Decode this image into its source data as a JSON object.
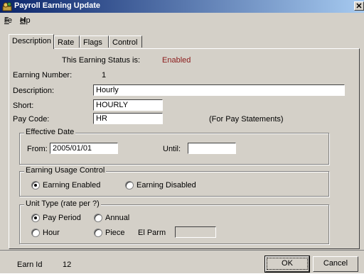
{
  "window": {
    "title": "Payroll Earning Update"
  },
  "menu": {
    "file": "File",
    "help": "Help"
  },
  "tabs": [
    {
      "label": "Description",
      "active": true
    },
    {
      "label": "Rate",
      "active": false
    },
    {
      "label": "Flags",
      "active": false
    },
    {
      "label": "Control",
      "active": false
    }
  ],
  "status_line": {
    "label": "This Earning Status is:",
    "value": "Enabled",
    "value_color": "#8b1a1a"
  },
  "earning_number": {
    "label": "Earning Number:",
    "value": "1"
  },
  "description": {
    "label": "Description:",
    "value": "Hourly"
  },
  "short": {
    "label": "Short:",
    "value": "HOURLY"
  },
  "pay_code": {
    "label": "Pay Code:",
    "value": "HR",
    "note": "(For Pay Statements)"
  },
  "effective_date": {
    "legend": "Effective Date",
    "from_label": "From:",
    "from_value": "2005/01/01",
    "until_label": "Until:",
    "until_value": ""
  },
  "usage_control": {
    "legend": "Earning Usage Control",
    "enabled_label": "Earning Enabled",
    "disabled_label": "Earning Disabled",
    "selected": "enabled"
  },
  "unit_type": {
    "legend": "Unit Type (rate per ?)",
    "pay_period": "Pay Period",
    "annual": "Annual",
    "hour": "Hour",
    "piece": "Piece",
    "el_parm_label": "El Parm",
    "el_parm_value": "",
    "selected": "pay_period"
  },
  "footer": {
    "earn_id_label": "Earn Id",
    "earn_id_value": "12"
  },
  "buttons": {
    "ok": "OK",
    "cancel": "Cancel"
  }
}
